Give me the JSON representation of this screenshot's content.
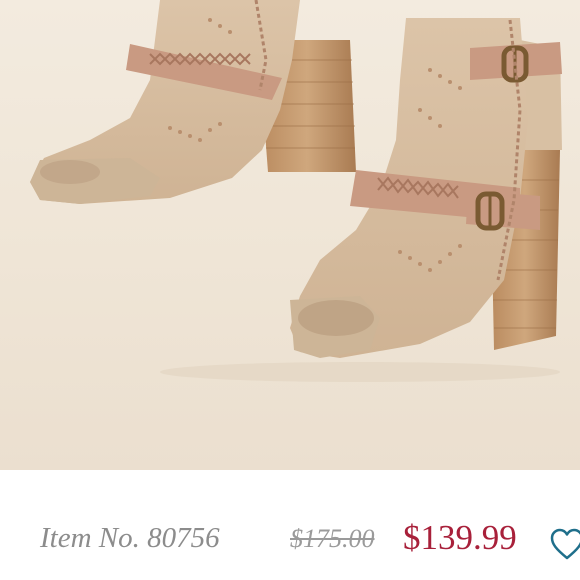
{
  "product": {
    "image_subject": "perforated suede peep-toe block-heel buckle booties",
    "item_number": "Item No. 80756",
    "original_price": "$175.00",
    "sale_price": "$139.99"
  },
  "icons": {
    "favorite": "heart-outline-icon"
  },
  "colors": {
    "sale_price": "#a8203a",
    "heart_outline": "#1f6f8b",
    "muted_text": "#8c8c8c"
  }
}
